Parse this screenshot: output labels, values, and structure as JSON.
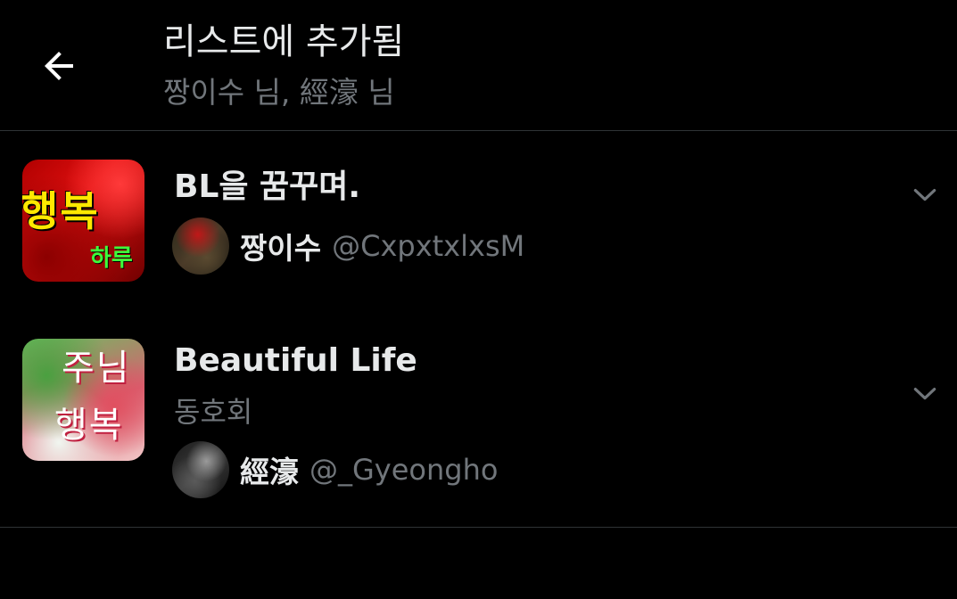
{
  "header": {
    "back_icon": "arrow-left-icon",
    "title": "리스트에 추가됨",
    "subtitle": "짱이수 님, 經濠 님"
  },
  "lists": [
    {
      "name": "BL을 꿈꾸며.",
      "description": "",
      "thumbnail_text_big": "행복",
      "thumbnail_text_small": "하루",
      "owner": {
        "display_name": "짱이수",
        "handle": "@CxpxtxlxsM"
      },
      "menu_icon": "chevron-down-icon"
    },
    {
      "name": "Beautiful Life",
      "description": "동호회",
      "thumbnail_text_top": "주님",
      "thumbnail_text_bottom": "행복",
      "owner": {
        "display_name": "經濠",
        "handle": "@_Gyeongho"
      },
      "menu_icon": "chevron-down-icon"
    }
  ],
  "colors": {
    "background": "#000000",
    "primary_text": "#e7e9ea",
    "secondary_text": "#71767b",
    "divider": "#2f3336"
  }
}
